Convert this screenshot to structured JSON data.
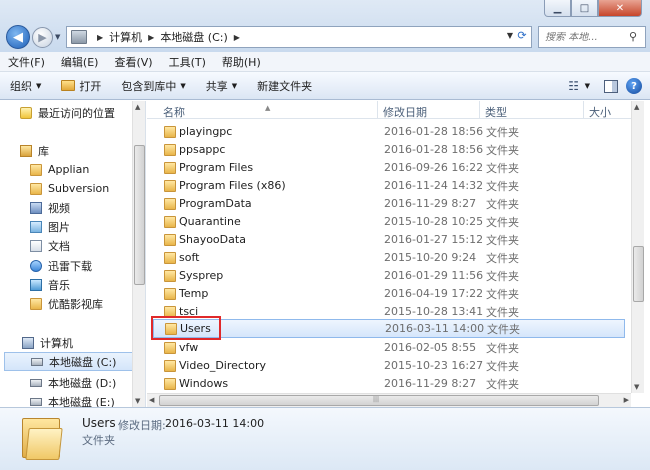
{
  "window": {
    "minimize_glyph": "▁",
    "maximize_glyph": "□",
    "close_glyph": "✕"
  },
  "nav": {
    "back_glyph": "◀",
    "forward_glyph": "▶"
  },
  "address": {
    "crumbs": [
      "计算机",
      "本地磁盘 (C:)"
    ]
  },
  "search": {
    "placeholder": "搜索 本地..."
  },
  "menu": [
    "文件(F)",
    "编辑(E)",
    "查看(V)",
    "工具(T)",
    "帮助(H)"
  ],
  "toolbar": {
    "organize": "组织",
    "open": "打开",
    "include": "包含到库中",
    "share": "共享",
    "new_folder": "新建文件夹"
  },
  "sidebar": {
    "items": [
      {
        "label": "最近访问的位置",
        "icon": "recent-places-icon"
      },
      {
        "label": "库",
        "icon": "library-icon"
      },
      {
        "label": "Applian",
        "icon": "folder-icon"
      },
      {
        "label": "Subversion",
        "icon": "folder-icon"
      },
      {
        "label": "视频",
        "icon": "videos-library-icon"
      },
      {
        "label": "图片",
        "icon": "pictures-library-icon"
      },
      {
        "label": "文档",
        "icon": "documents-library-icon"
      },
      {
        "label": "迅雷下载",
        "icon": "thunder-download-icon"
      },
      {
        "label": "音乐",
        "icon": "music-library-icon"
      },
      {
        "label": "优酷影视库",
        "icon": "folder-icon"
      },
      {
        "label": "计算机",
        "icon": "computer-icon"
      },
      {
        "label": "本地磁盘 (C:)",
        "icon": "drive-icon"
      },
      {
        "label": "本地磁盘 (D:)",
        "icon": "drive-icon"
      },
      {
        "label": "本地磁盘 (E:)",
        "icon": "drive-icon"
      }
    ]
  },
  "columns": {
    "name": "名称",
    "date": "修改日期",
    "type": "类型",
    "size": "大小"
  },
  "files": [
    {
      "name": "playingpc",
      "date": "2016-01-28 18:56",
      "type": "文件夹"
    },
    {
      "name": "ppsappc",
      "date": "2016-01-28 18:56",
      "type": "文件夹"
    },
    {
      "name": "Program Files",
      "date": "2016-09-26 16:22",
      "type": "文件夹"
    },
    {
      "name": "Program Files (x86)",
      "date": "2016-11-24 14:32",
      "type": "文件夹"
    },
    {
      "name": "ProgramData",
      "date": "2016-11-29 8:27",
      "type": "文件夹"
    },
    {
      "name": "Quarantine",
      "date": "2015-10-28 10:25",
      "type": "文件夹"
    },
    {
      "name": "ShayooData",
      "date": "2016-01-27 15:12",
      "type": "文件夹"
    },
    {
      "name": "soft",
      "date": "2015-10-20 9:24",
      "type": "文件夹"
    },
    {
      "name": "Sysprep",
      "date": "2016-01-29 11:56",
      "type": "文件夹"
    },
    {
      "name": "Temp",
      "date": "2016-04-19 17:22",
      "type": "文件夹"
    },
    {
      "name": "tsci",
      "date": "2015-10-28 13:41",
      "type": "文件夹"
    },
    {
      "name": "Users",
      "date": "2016-03-11 14:00",
      "type": "文件夹"
    },
    {
      "name": "vfw",
      "date": "2016-02-05 8:55",
      "type": "文件夹"
    },
    {
      "name": "Video_Directory",
      "date": "2015-10-23 16:27",
      "type": "文件夹"
    },
    {
      "name": "Windows",
      "date": "2016-11-29 8:27",
      "type": "文件夹"
    }
  ],
  "details": {
    "name": "Users",
    "date_label": "修改日期:",
    "date": "2016-03-11 14:00",
    "type": "文件夹"
  }
}
